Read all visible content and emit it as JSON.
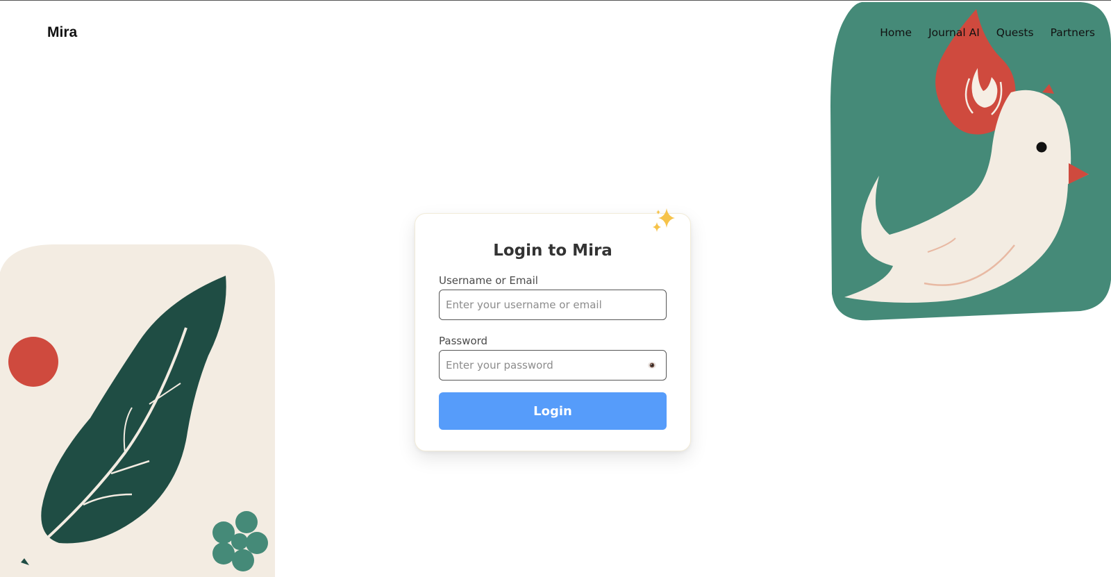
{
  "header": {
    "logo": "Mira",
    "nav": [
      {
        "label": "Home"
      },
      {
        "label": "Journal AI"
      },
      {
        "label": "Quests"
      },
      {
        "label": "Partners"
      }
    ]
  },
  "login": {
    "title": "Login to Mira",
    "username_label": "Username or Email",
    "username_placeholder": "Enter your username or email",
    "username_value": "",
    "password_label": "Password",
    "password_placeholder": "Enter your password",
    "password_value": "",
    "submit_label": "Login",
    "sparkle_icon": "sparkles-icon",
    "toggle_icon": "eye-icon"
  },
  "colors": {
    "accent": "#569cfa",
    "green": "#458a78",
    "dark_green": "#1f4d44",
    "red": "#cf4a3e",
    "cream": "#f3ece2"
  }
}
